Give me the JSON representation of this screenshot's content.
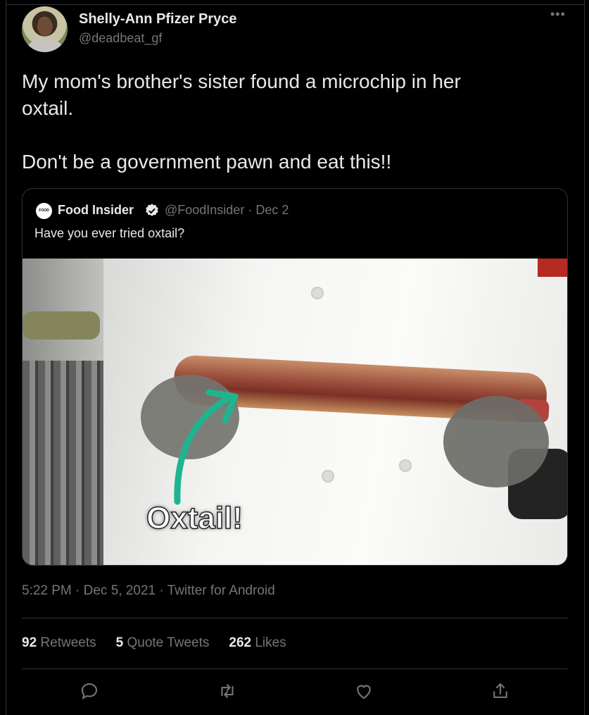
{
  "author": {
    "name": "Shelly-Ann Pfizer Pryce",
    "handle": "@deadbeat_gf",
    "avatar_icon": "avatar-photo"
  },
  "tweet": {
    "text": "My mom's brother's sister found a microchip in her\noxtail.\n\nDon't be a government pawn and eat this!!",
    "timestamp": "5:22 PM · Dec 5, 2021 · Twitter for Android"
  },
  "quoted": {
    "logo_text": "FOOD INSIDER",
    "name": "Food Insider",
    "verified_icon": "verified-badge-icon",
    "handle": "@FoodInsider",
    "date": "Dec 2",
    "meta": "@FoodInsider · Dec 2",
    "text": "Have you ever tried oxtail?",
    "media_caption": "Oxtail!"
  },
  "stats": {
    "retweets_count": "92",
    "retweets_label": "Retweets",
    "quotes_count": "5",
    "quotes_label": "Quote Tweets",
    "likes_count": "262",
    "likes_label": "Likes"
  },
  "actions": [
    "reply-icon",
    "retweet-icon",
    "like-icon",
    "share-icon"
  ],
  "colors": {
    "background": "#000000",
    "text": "#e7e9ea",
    "secondary": "#71767b",
    "border": "#2f3336",
    "verified": "#e7e9ea",
    "arrow": "#1fb48f"
  }
}
